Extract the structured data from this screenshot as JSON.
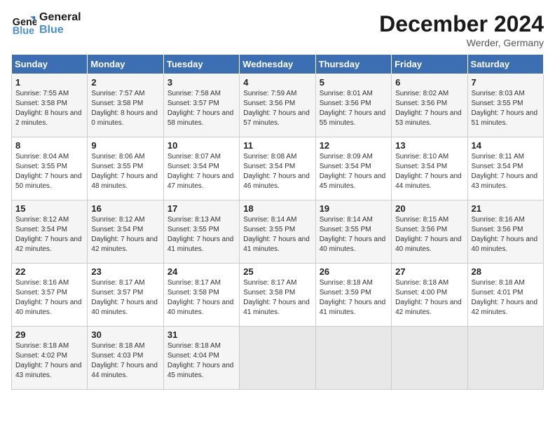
{
  "logo": {
    "line1": "General",
    "line2": "Blue"
  },
  "title": "December 2024",
  "subtitle": "Werder, Germany",
  "days_of_week": [
    "Sunday",
    "Monday",
    "Tuesday",
    "Wednesday",
    "Thursday",
    "Friday",
    "Saturday"
  ],
  "weeks": [
    [
      {
        "num": "1",
        "sunrise": "7:55 AM",
        "sunset": "3:58 PM",
        "daylight": "8 hours and 2 minutes."
      },
      {
        "num": "2",
        "sunrise": "7:57 AM",
        "sunset": "3:58 PM",
        "daylight": "8 hours and 0 minutes."
      },
      {
        "num": "3",
        "sunrise": "7:58 AM",
        "sunset": "3:57 PM",
        "daylight": "7 hours and 58 minutes."
      },
      {
        "num": "4",
        "sunrise": "7:59 AM",
        "sunset": "3:56 PM",
        "daylight": "7 hours and 57 minutes."
      },
      {
        "num": "5",
        "sunrise": "8:01 AM",
        "sunset": "3:56 PM",
        "daylight": "7 hours and 55 minutes."
      },
      {
        "num": "6",
        "sunrise": "8:02 AM",
        "sunset": "3:56 PM",
        "daylight": "7 hours and 53 minutes."
      },
      {
        "num": "7",
        "sunrise": "8:03 AM",
        "sunset": "3:55 PM",
        "daylight": "7 hours and 51 minutes."
      }
    ],
    [
      {
        "num": "8",
        "sunrise": "8:04 AM",
        "sunset": "3:55 PM",
        "daylight": "7 hours and 50 minutes."
      },
      {
        "num": "9",
        "sunrise": "8:06 AM",
        "sunset": "3:55 PM",
        "daylight": "7 hours and 48 minutes."
      },
      {
        "num": "10",
        "sunrise": "8:07 AM",
        "sunset": "3:54 PM",
        "daylight": "7 hours and 47 minutes."
      },
      {
        "num": "11",
        "sunrise": "8:08 AM",
        "sunset": "3:54 PM",
        "daylight": "7 hours and 46 minutes."
      },
      {
        "num": "12",
        "sunrise": "8:09 AM",
        "sunset": "3:54 PM",
        "daylight": "7 hours and 45 minutes."
      },
      {
        "num": "13",
        "sunrise": "8:10 AM",
        "sunset": "3:54 PM",
        "daylight": "7 hours and 44 minutes."
      },
      {
        "num": "14",
        "sunrise": "8:11 AM",
        "sunset": "3:54 PM",
        "daylight": "7 hours and 43 minutes."
      }
    ],
    [
      {
        "num": "15",
        "sunrise": "8:12 AM",
        "sunset": "3:54 PM",
        "daylight": "7 hours and 42 minutes."
      },
      {
        "num": "16",
        "sunrise": "8:12 AM",
        "sunset": "3:54 PM",
        "daylight": "7 hours and 42 minutes."
      },
      {
        "num": "17",
        "sunrise": "8:13 AM",
        "sunset": "3:55 PM",
        "daylight": "7 hours and 41 minutes."
      },
      {
        "num": "18",
        "sunrise": "8:14 AM",
        "sunset": "3:55 PM",
        "daylight": "7 hours and 41 minutes."
      },
      {
        "num": "19",
        "sunrise": "8:14 AM",
        "sunset": "3:55 PM",
        "daylight": "7 hours and 40 minutes."
      },
      {
        "num": "20",
        "sunrise": "8:15 AM",
        "sunset": "3:56 PM",
        "daylight": "7 hours and 40 minutes."
      },
      {
        "num": "21",
        "sunrise": "8:16 AM",
        "sunset": "3:56 PM",
        "daylight": "7 hours and 40 minutes."
      }
    ],
    [
      {
        "num": "22",
        "sunrise": "8:16 AM",
        "sunset": "3:57 PM",
        "daylight": "7 hours and 40 minutes."
      },
      {
        "num": "23",
        "sunrise": "8:17 AM",
        "sunset": "3:57 PM",
        "daylight": "7 hours and 40 minutes."
      },
      {
        "num": "24",
        "sunrise": "8:17 AM",
        "sunset": "3:58 PM",
        "daylight": "7 hours and 40 minutes."
      },
      {
        "num": "25",
        "sunrise": "8:17 AM",
        "sunset": "3:58 PM",
        "daylight": "7 hours and 41 minutes."
      },
      {
        "num": "26",
        "sunrise": "8:18 AM",
        "sunset": "3:59 PM",
        "daylight": "7 hours and 41 minutes."
      },
      {
        "num": "27",
        "sunrise": "8:18 AM",
        "sunset": "4:00 PM",
        "daylight": "7 hours and 42 minutes."
      },
      {
        "num": "28",
        "sunrise": "8:18 AM",
        "sunset": "4:01 PM",
        "daylight": "7 hours and 42 minutes."
      }
    ],
    [
      {
        "num": "29",
        "sunrise": "8:18 AM",
        "sunset": "4:02 PM",
        "daylight": "7 hours and 43 minutes."
      },
      {
        "num": "30",
        "sunrise": "8:18 AM",
        "sunset": "4:03 PM",
        "daylight": "7 hours and 44 minutes."
      },
      {
        "num": "31",
        "sunrise": "8:18 AM",
        "sunset": "4:04 PM",
        "daylight": "7 hours and 45 minutes."
      },
      null,
      null,
      null,
      null
    ]
  ]
}
